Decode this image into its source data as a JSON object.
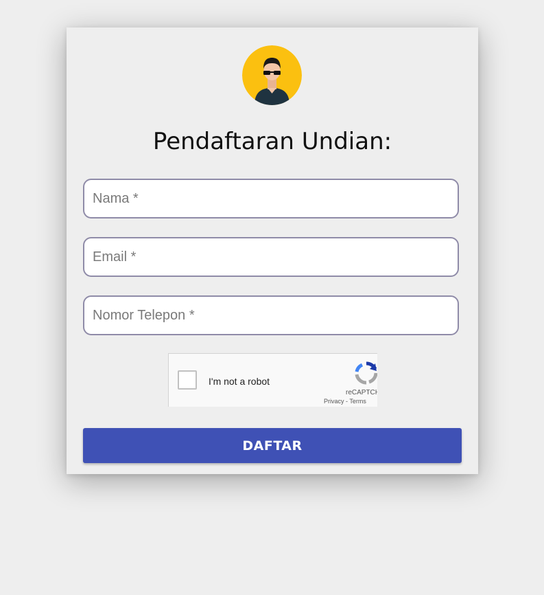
{
  "form": {
    "title": "Pendaftaran Undian:",
    "avatar_icon": "user-avatar-sunglasses-icon",
    "fields": {
      "nama": {
        "placeholder": "Nama *",
        "value": ""
      },
      "email": {
        "placeholder": "Email *",
        "value": ""
      },
      "telepon": {
        "placeholder": "Nomor Telepon *",
        "value": ""
      }
    },
    "recaptcha": {
      "label": "I'm not a robot",
      "brand": "reCAPTCHA",
      "privacy": "Privacy",
      "separator": " - ",
      "terms": "Terms",
      "logo_icon": "recaptcha-logo-icon"
    },
    "submit_label": "DAFTAR"
  },
  "colors": {
    "background": "#eeeeee",
    "accent": "#3f51b5",
    "avatar_bg": "#fbc010",
    "field_border": "#8f8ba8"
  }
}
